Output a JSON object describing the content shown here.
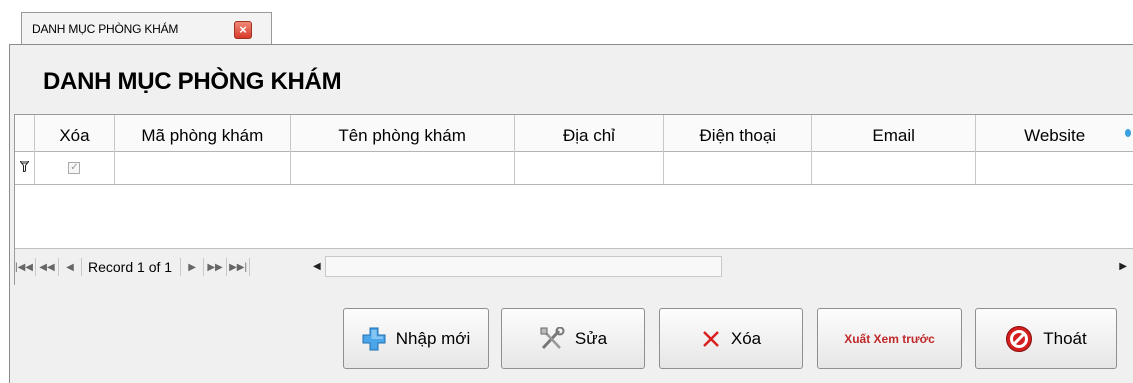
{
  "tab": {
    "label": "DANH MỤC PHÒNG KHÁM",
    "close": "×"
  },
  "title": "DANH MỤC PHÒNG KHÁM",
  "grid": {
    "columns": [
      "Xóa",
      "Mã phòng khám",
      "Tên phòng khám",
      "Địa chỉ",
      "Điện thoại",
      "Email",
      "Website"
    ],
    "filter_row_checkbox": "✓",
    "navigator": {
      "record_text": "Record 1 of 1"
    }
  },
  "buttons": {
    "new": "Nhập mới",
    "edit": "Sửa",
    "delete": "Xóa",
    "export": "Xuất Xem trước",
    "exit": "Thoát"
  }
}
